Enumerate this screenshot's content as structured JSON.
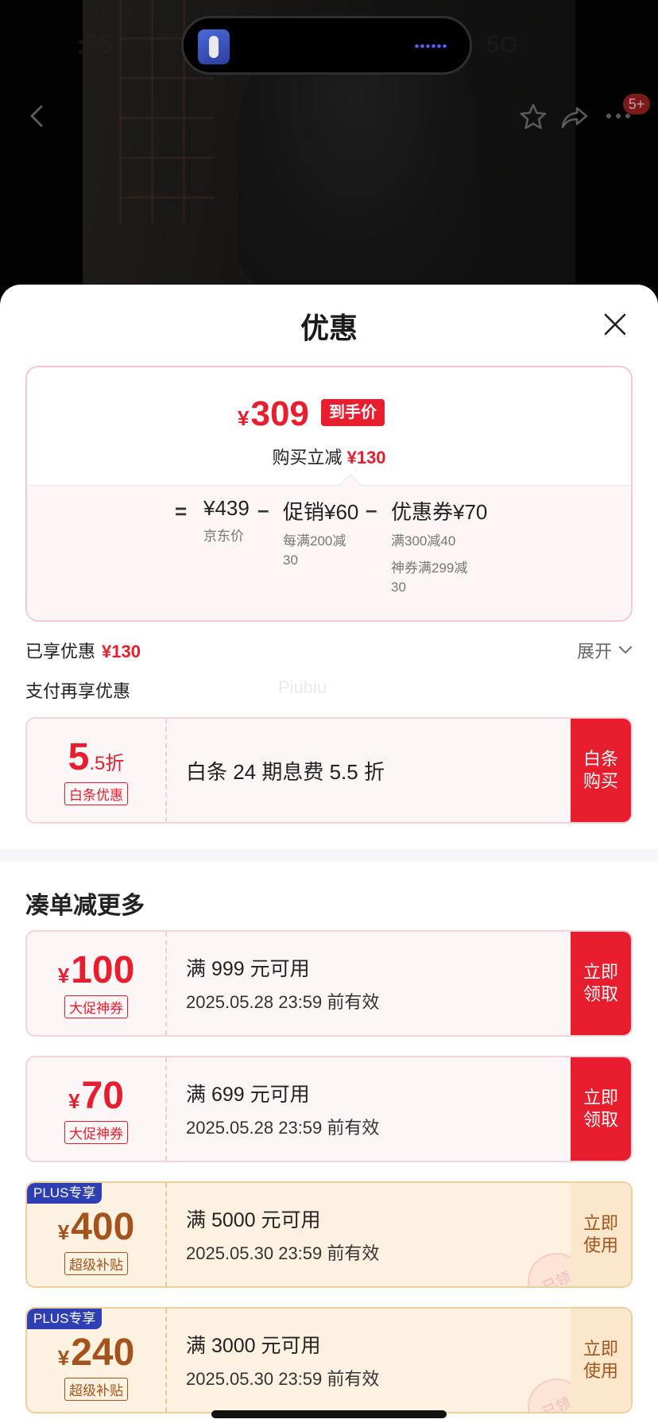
{
  "status_bar": {
    "time": ":55",
    "network": "5G"
  },
  "top_nav": {
    "badge": "5+"
  },
  "sheet": {
    "title": "优惠"
  },
  "price_summary": {
    "currency": "¥",
    "final_price": "309",
    "final_tag": "到手价",
    "instant_label": "购买立减",
    "instant_amount": "¥130",
    "equals": "=",
    "minus": "–",
    "breakdown": [
      {
        "main": "¥439",
        "sub": [
          "京东价"
        ]
      },
      {
        "main": "促销¥60",
        "sub": [
          "每满200减",
          "30"
        ]
      },
      {
        "main": "优惠券¥70",
        "sub": [
          "满300减40",
          "神券满299减",
          "30"
        ]
      }
    ]
  },
  "enjoyed": {
    "label": "已享优惠",
    "amount": "¥130",
    "expand_label": "展开"
  },
  "pay_more": {
    "label": "支付再享优惠",
    "watermark": "Piubiu"
  },
  "baitiao_card": {
    "amount_big": "5",
    "amount_small": ".5折",
    "tag": "白条优惠",
    "description": "白条 24 期息费 5.5 折",
    "button": "白条购买"
  },
  "more_section": {
    "title": "凑单减更多"
  },
  "coupons": [
    {
      "currency": "¥",
      "amount": "100",
      "tag": "大促神券",
      "condition": "满 999 元可用",
      "expiry": "2025.05.28 23:59 前有效",
      "button": "立即领取",
      "plus": false
    },
    {
      "currency": "¥",
      "amount": "70",
      "tag": "大促神券",
      "condition": "满 699 元可用",
      "expiry": "2025.05.28 23:59 前有效",
      "button": "立即领取",
      "plus": false
    },
    {
      "currency": "¥",
      "amount": "400",
      "tag": "超级补贴",
      "condition": "满 5000 元可用",
      "expiry": "2025.05.30 23:59 前有效",
      "button": "立即使用",
      "plus": true,
      "plus_label": "PLUS专享",
      "stamp": "已领"
    },
    {
      "currency": "¥",
      "amount": "240",
      "tag": "超级补贴",
      "condition": "满 3000 元可用",
      "expiry": "2025.05.30 23:59 前有效",
      "button": "立即使用",
      "plus": true,
      "plus_label": "PLUS专享",
      "stamp": "已领"
    }
  ],
  "colors": {
    "accent_red": "#e81e2e",
    "plus_brown": "#a4541a",
    "plus_blue": "#2e3fb4"
  },
  "icons": [
    "back-arrow-icon",
    "star-icon",
    "share-icon",
    "more-icon",
    "close-icon",
    "chevron-down-icon"
  ]
}
